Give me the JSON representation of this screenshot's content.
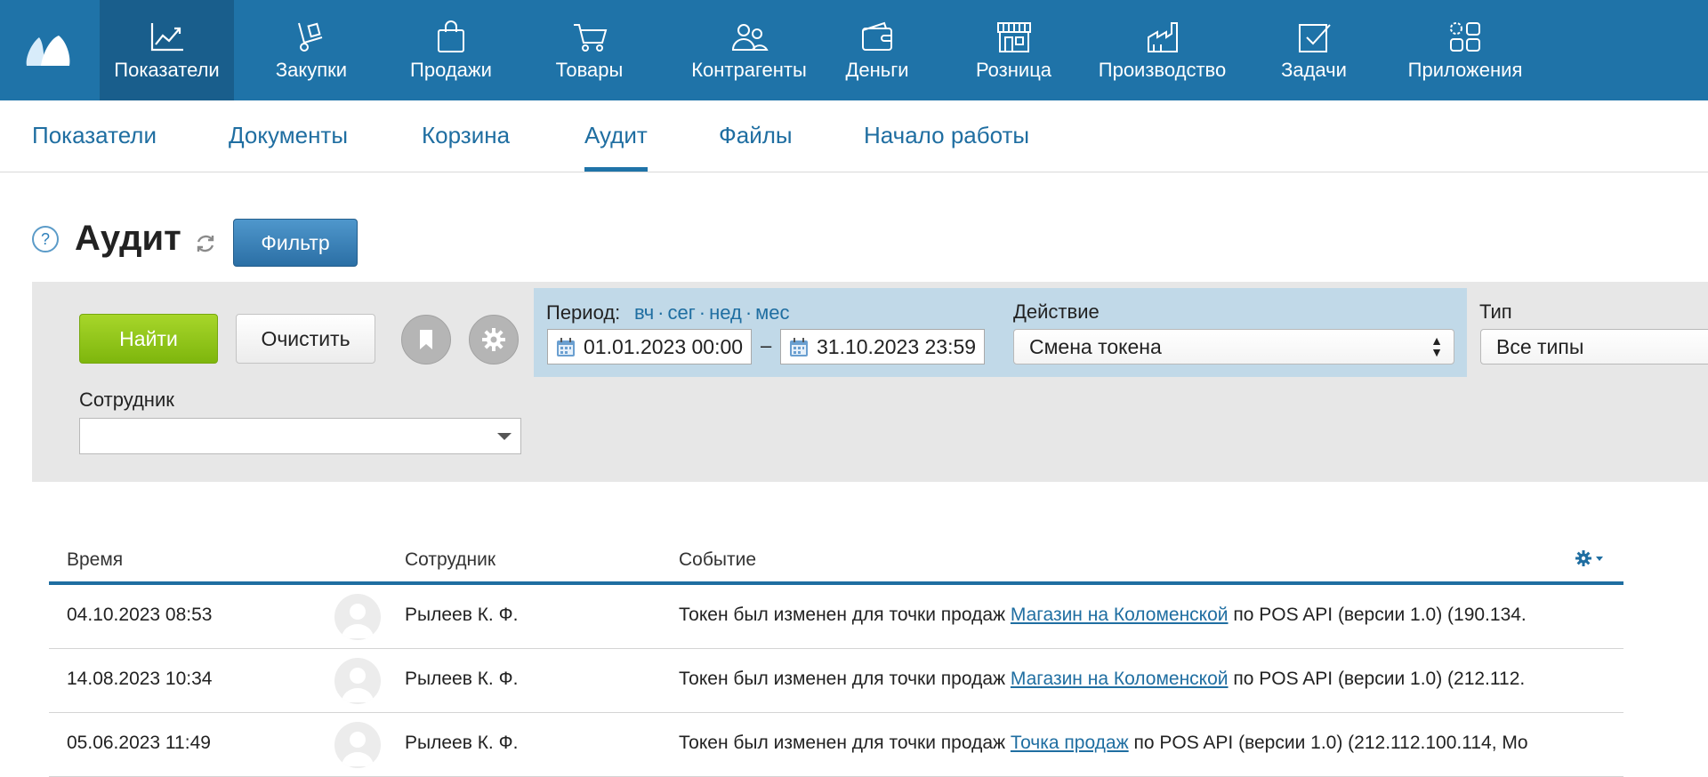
{
  "top_nav": {
    "items": [
      {
        "label": "Показатели",
        "icon": "chart-line-icon",
        "active": true
      },
      {
        "label": "Закупки",
        "icon": "hand-truck-icon"
      },
      {
        "label": "Продажи",
        "icon": "shopping-bag-icon"
      },
      {
        "label": "Товары",
        "icon": "cart-icon"
      },
      {
        "label": "Контрагенты",
        "icon": "people-icon"
      },
      {
        "label": "Деньги",
        "icon": "wallet-icon"
      },
      {
        "label": "Розница",
        "icon": "store-icon"
      },
      {
        "label": "Производство",
        "icon": "factory-icon"
      },
      {
        "label": "Задачи",
        "icon": "task-check-icon"
      },
      {
        "label": "Приложения",
        "icon": "apps-icon"
      }
    ]
  },
  "sub_nav": {
    "tabs": [
      {
        "label": "Показатели"
      },
      {
        "label": "Документы"
      },
      {
        "label": "Корзина"
      },
      {
        "label": "Аудит",
        "active": true
      },
      {
        "label": "Файлы"
      },
      {
        "label": "Начало работы"
      }
    ]
  },
  "page": {
    "help": "?",
    "title": "Аудит",
    "filter_button": "Фильтр"
  },
  "filter": {
    "find_label": "Найти",
    "clear_label": "Очистить",
    "period_label": "Период:",
    "quick_links": [
      "вч",
      "сег",
      "нед",
      "мес"
    ],
    "quick_sep": "·",
    "date_from": "01.01.2023 00:00",
    "date_dash": "–",
    "date_to": "31.10.2023 23:59",
    "action_label": "Действие",
    "action_value": "Смена токена",
    "type_label": "Тип",
    "type_value": "Все типы",
    "employee_label": "Сотрудник",
    "employee_value": ""
  },
  "table": {
    "columns": [
      "Время",
      "Сотрудник",
      "Событие"
    ],
    "rows": [
      {
        "time": "04.10.2023 08:53",
        "employee": "Рылеев К. Ф.",
        "event_prefix": "Токен был изменен для точки продаж ",
        "event_link": "Магазин на Коломенской",
        "event_suffix": " по POS API (версии 1.0) (190.134."
      },
      {
        "time": "14.08.2023 10:34",
        "employee": "Рылеев К. Ф.",
        "event_prefix": "Токен был изменен для точки продаж ",
        "event_link": "Магазин на Коломенской",
        "event_suffix": " по POS API (версии 1.0) (212.112."
      },
      {
        "time": "05.06.2023 11:49",
        "employee": "Рылеев К. Ф.",
        "event_prefix": "Токен был изменен для точки продаж ",
        "event_link": "Точка продаж",
        "event_suffix": " по POS API (версии 1.0) (212.112.100.114, Mo"
      }
    ]
  },
  "colors": {
    "header_bg": "#1f73a8",
    "header_active": "#195e8c",
    "link": "#1f6ea1",
    "find_green": "#8cc11a"
  }
}
